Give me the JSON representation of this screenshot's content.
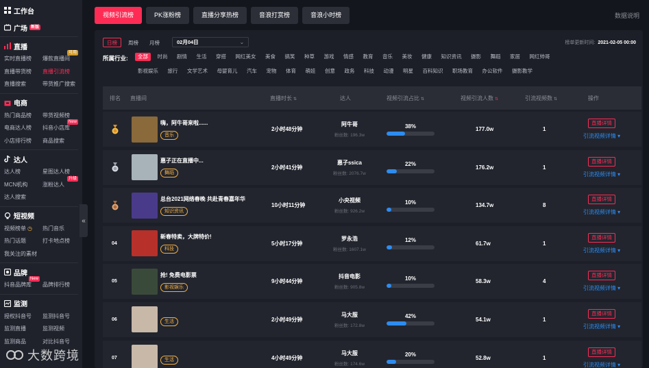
{
  "sidebar": {
    "workbench": "工作台",
    "square": {
      "label": "广场",
      "tag": "新版"
    },
    "live": {
      "label": "直播",
      "items": [
        {
          "label": "实时直播榜",
          "tag": ""
        },
        {
          "label": "爆款直播间",
          "tag": "可用"
        },
        {
          "label": "直播带货榜",
          "tag": ""
        },
        {
          "label": "直播引流榜",
          "tag": ""
        },
        {
          "label": "直播搜索",
          "tag": ""
        },
        {
          "label": "带货推广搜索",
          "tag": ""
        }
      ]
    },
    "ecom": {
      "label": "电商",
      "items": [
        {
          "label": "热门商品榜",
          "tag": ""
        },
        {
          "label": "带货视频榜",
          "tag": ""
        },
        {
          "label": "电商达人榜",
          "tag": ""
        },
        {
          "label": "抖音小店库",
          "tag": "New"
        },
        {
          "label": "小店排行榜",
          "tag": ""
        },
        {
          "label": "商品搜索",
          "tag": ""
        }
      ]
    },
    "kol": {
      "label": "达人",
      "items": [
        {
          "label": "达人榜",
          "tag": ""
        },
        {
          "label": "星图达人榜",
          "tag": ""
        },
        {
          "label": "MCN机构",
          "tag": ""
        },
        {
          "label": "涨粉达人",
          "tag": "升级"
        },
        {
          "label": "达人搜索",
          "tag": ""
        }
      ]
    },
    "video": {
      "label": "短视频",
      "items": [
        {
          "label": "视频榜单",
          "tag": ""
        },
        {
          "label": "热门音乐",
          "tag": ""
        },
        {
          "label": "热门话题",
          "tag": ""
        },
        {
          "label": "打卡地点榜",
          "tag": ""
        },
        {
          "label": "我关注的素材",
          "tag": ""
        }
      ]
    },
    "brand": {
      "label": "品牌",
      "items": [
        {
          "label": "抖音品牌库",
          "tag": "New"
        },
        {
          "label": "品牌排行榜",
          "tag": ""
        }
      ]
    },
    "monitor": {
      "label": "监测",
      "items": [
        {
          "label": "授权抖音号",
          "tag": ""
        },
        {
          "label": "监测抖音号",
          "tag": ""
        },
        {
          "label": "监测直播",
          "tag": ""
        },
        {
          "label": "监测视频",
          "tag": ""
        },
        {
          "label": "监测商品",
          "tag": ""
        },
        {
          "label": "对比抖音号",
          "tag": ""
        }
      ]
    },
    "collapse": "«",
    "watermark": "大数跨境"
  },
  "tabs": [
    "视频引流榜",
    "PK涨粉榜",
    "直播分享热榜",
    "音浪打赏榜",
    "音浪小时榜"
  ],
  "data_help": "数据说明",
  "period_tabs": [
    "日榜",
    "周榜",
    "月榜"
  ],
  "date_value": "02月04日",
  "update": {
    "label": "榜单更新时间:",
    "value": "2021-02-05 00:00"
  },
  "industry": {
    "label": "所属行业:",
    "row1": [
      "全部",
      "时尚",
      "剧情",
      "生活",
      "穿搭",
      "网红美女",
      "美食",
      "搞笑",
      "种草",
      "游戏",
      "情感",
      "教育",
      "音乐",
      "美妆",
      "健康",
      "知识资讯",
      "摄影",
      "舞蹈",
      "家居",
      "网红帅哥"
    ],
    "row2": [
      "影视娱乐",
      "旅行",
      "文学艺术",
      "母婴育儿",
      "汽车",
      "宠物",
      "体育",
      "萌娃",
      "创意",
      "政务",
      "科技",
      "动漫",
      "明星",
      "百科知识",
      "职场教育",
      "办公软件",
      "摄影教学"
    ]
  },
  "columns": {
    "rank": "排名",
    "live": "直播间",
    "duration": "直播时长",
    "talent": "达人",
    "ratio": "视频引流占比",
    "people": "视频引流人数",
    "count": "引流视频数",
    "ops": "操作"
  },
  "fans_label": "粉丝数:",
  "btn_detail": "直播详情",
  "link_detail": "引流视频详情",
  "rows": [
    {
      "rank": "1",
      "medal": "gold",
      "title": "嗨，阿牛哥来啦......",
      "category": "音乐",
      "duration": "2小时48分钟",
      "talent": "阿牛哥",
      "fans": "196.3w",
      "ratio": "38%",
      "ratio_value": 0.38,
      "people": "177.0w",
      "count": "1",
      "thumb_color": "#8a6a3a"
    },
    {
      "rank": "2",
      "medal": "silver",
      "title": "惠子正在直播中...",
      "category": "舞蹈",
      "duration": "2小时41分钟",
      "talent": "惠子ssica",
      "fans": "2076.7w",
      "ratio": "22%",
      "ratio_value": 0.22,
      "people": "176.2w",
      "count": "1",
      "thumb_color": "#a7b3b8"
    },
    {
      "rank": "3",
      "medal": "bronze",
      "title": "总台2021网络春晚 共赴青春嘉年华",
      "category": "知识资讯",
      "duration": "10小时11分钟",
      "talent": "小央视频",
      "fans": "926.2w",
      "ratio": "10%",
      "ratio_value": 0.1,
      "people": "134.7w",
      "count": "8",
      "thumb_color": "#4a3a8a"
    },
    {
      "rank": "04",
      "medal": "",
      "title": "新春特卖，大牌特价!",
      "category": "科技",
      "duration": "5小时17分钟",
      "talent": "罗永浩",
      "fans": "1607.1w",
      "ratio": "12%",
      "ratio_value": 0.12,
      "people": "61.7w",
      "count": "1",
      "thumb_color": "#b8302a"
    },
    {
      "rank": "05",
      "medal": "",
      "title": "抢! 免费电影票",
      "category": "影视娱乐",
      "duration": "9小时44分钟",
      "talent": "抖音电影",
      "fans": "905.8w",
      "ratio": "10%",
      "ratio_value": 0.1,
      "people": "58.3w",
      "count": "4",
      "thumb_color": "#3a4a3a"
    },
    {
      "rank": "06",
      "medal": "",
      "title": "",
      "category": "生活",
      "duration": "2小时49分钟",
      "talent": "马大服",
      "fans": "172.8w",
      "ratio": "42%",
      "ratio_value": 0.42,
      "people": "54.1w",
      "count": "1",
      "thumb_color": "#c8b8a8"
    },
    {
      "rank": "07",
      "medal": "",
      "title": "",
      "category": "生活",
      "duration": "4小时49分钟",
      "talent": "马大服",
      "fans": "174.6w",
      "ratio": "20%",
      "ratio_value": 0.2,
      "people": "52.8w",
      "count": "1",
      "thumb_color": "#c8b8a8"
    }
  ],
  "colors": {
    "accent": "#fe2c55",
    "bar": "#2d8cf0",
    "link": "#2d8cf0",
    "category": "#f5b041"
  }
}
